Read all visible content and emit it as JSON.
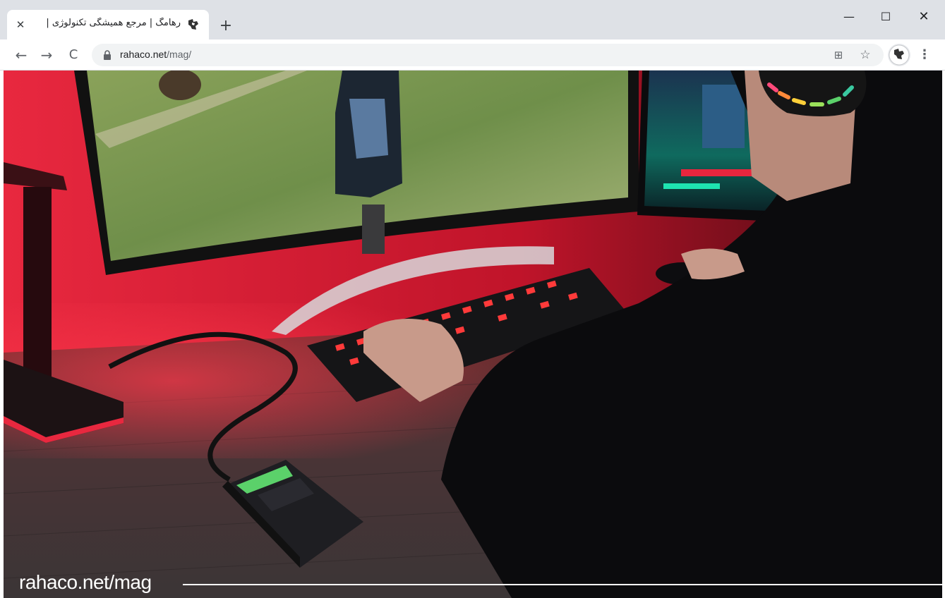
{
  "browser": {
    "tab": {
      "title": "رهامگ | مرجع همیشگی تکنولوژی |",
      "close_glyph": "✕",
      "favicon": "rahaco-icon"
    },
    "new_tab_glyph": "+",
    "window_controls": {
      "minimize": "—",
      "maximize": "☐",
      "close": "✕"
    },
    "toolbar": {
      "back_glyph": "←",
      "forward_glyph": "→",
      "reload_glyph": "C",
      "url_host": "rahaco.net",
      "url_path": "/mag/",
      "translate_glyph": "⊞",
      "star_glyph": "☆",
      "menu_glyph": "⋮"
    }
  },
  "content": {
    "image_subject": "gaming-desk-scene",
    "watermark_prefix": "rahaco.net/",
    "watermark_suffix": "mag"
  },
  "colors": {
    "tabstrip": "#dee1e6",
    "omnibox": "#f1f3f4",
    "accent_red": "#e3122a",
    "accent_green": "#5bd16a"
  }
}
